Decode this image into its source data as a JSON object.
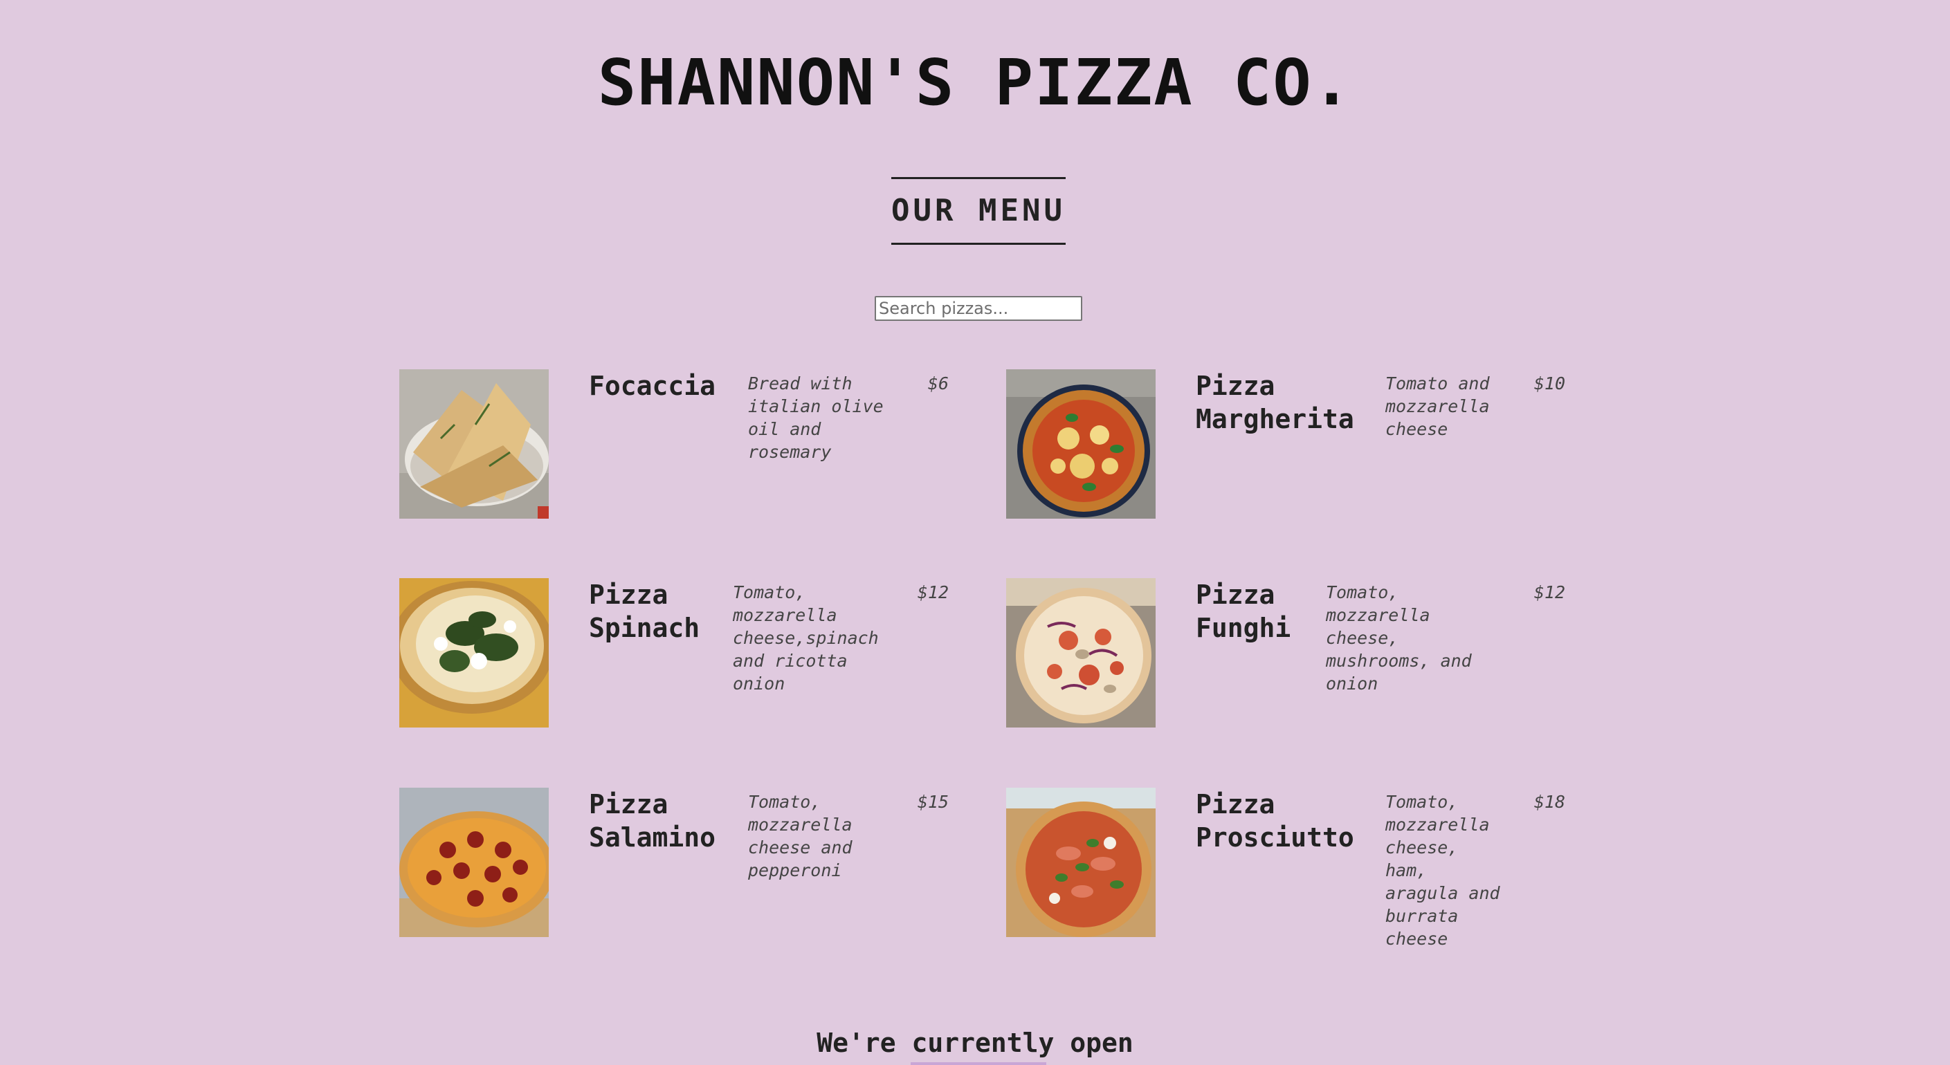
{
  "header": {
    "title": "SHANNON'S PIZZA CO.",
    "menu_heading": "OUR MENU"
  },
  "search": {
    "placeholder": "Search pizzas...",
    "value": ""
  },
  "menu": {
    "items": [
      {
        "name": "Focaccia",
        "description": "Bread with italian olive oil and rosemary",
        "price": "$6",
        "image": "focaccia-photo"
      },
      {
        "name": "Pizza Margherita",
        "description": "Tomato and mozzarella cheese",
        "price": "$10",
        "image": "margherita-photo"
      },
      {
        "name": "Pizza Spinach",
        "description": "Tomato, mozzarella cheese,spinach and ricotta onion",
        "price": "$12",
        "image": "spinach-pizza-photo"
      },
      {
        "name": "Pizza Funghi",
        "description": "Tomato, mozzarella cheese, mushrooms, and onion",
        "price": "$12",
        "image": "funghi-pizza-photo"
      },
      {
        "name": "Pizza Salamino",
        "description": "Tomato, mozzarella cheese and pepperoni",
        "price": "$15",
        "image": "salamino-pizza-photo"
      },
      {
        "name": "Pizza Prosciutto",
        "description": "Tomato, mozzarella cheese, ham, aragula and burrata cheese",
        "price": "$18",
        "image": "prosciutto-pizza-photo"
      }
    ]
  },
  "footer": {
    "status": "We're currently open"
  },
  "colors": {
    "background": "#e0cadf",
    "text": "#222222",
    "muted_text": "#444444"
  }
}
